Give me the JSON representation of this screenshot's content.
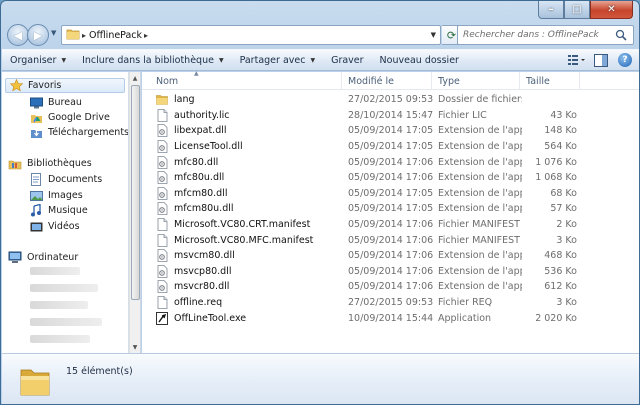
{
  "address": {
    "crumb": "OfflinePack"
  },
  "search": {
    "placeholder": "Rechercher dans : OfflinePack"
  },
  "toolbar": {
    "organize": "Organiser",
    "include_library": "Inclure dans la bibliothèque",
    "share_with": "Partager avec",
    "burn": "Graver",
    "new_folder": "Nouveau dossier"
  },
  "nav": {
    "favorites": "Favoris",
    "desktop": "Bureau",
    "google_drive": "Google Drive",
    "downloads": "Téléchargements",
    "libraries": "Bibliothèques",
    "documents": "Documents",
    "images": "Images",
    "music": "Musique",
    "videos": "Vidéos",
    "computer": "Ordinateur"
  },
  "columns": {
    "name": "Nom",
    "modified": "Modifié le",
    "type": "Type",
    "size": "Taille"
  },
  "files": [
    {
      "name": "lang",
      "date": "27/02/2015 09:53",
      "type": "Dossier de fichiers",
      "size": "",
      "icon": "folder-icon"
    },
    {
      "name": "authority.lic",
      "date": "28/10/2014 15:47",
      "type": "Fichier LIC",
      "size": "43 Ko",
      "icon": "file-icon"
    },
    {
      "name": "libexpat.dll",
      "date": "05/09/2014 17:05",
      "type": "Extension de l'app...",
      "size": "148 Ko",
      "icon": "dll-icon"
    },
    {
      "name": "LicenseTool.dll",
      "date": "05/09/2014 17:05",
      "type": "Extension de l'app...",
      "size": "564 Ko",
      "icon": "dll-icon"
    },
    {
      "name": "mfc80.dll",
      "date": "05/09/2014 17:06",
      "type": "Extension de l'app...",
      "size": "1 076 Ko",
      "icon": "dll-icon"
    },
    {
      "name": "mfc80u.dll",
      "date": "05/09/2014 17:06",
      "type": "Extension de l'app...",
      "size": "1 068 Ko",
      "icon": "dll-icon"
    },
    {
      "name": "mfcm80.dll",
      "date": "05/09/2014 17:05",
      "type": "Extension de l'app...",
      "size": "68 Ko",
      "icon": "dll-icon"
    },
    {
      "name": "mfcm80u.dll",
      "date": "05/09/2014 17:05",
      "type": "Extension de l'app...",
      "size": "57 Ko",
      "icon": "dll-icon"
    },
    {
      "name": "Microsoft.VC80.CRT.manifest",
      "date": "05/09/2014 17:06",
      "type": "Fichier MANIFEST",
      "size": "2 Ko",
      "icon": "file-icon"
    },
    {
      "name": "Microsoft.VC80.MFC.manifest",
      "date": "05/09/2014 17:06",
      "type": "Fichier MANIFEST",
      "size": "3 Ko",
      "icon": "file-icon"
    },
    {
      "name": "msvcm80.dll",
      "date": "05/09/2014 17:06",
      "type": "Extension de l'app...",
      "size": "468 Ko",
      "icon": "dll-icon"
    },
    {
      "name": "msvcp80.dll",
      "date": "05/09/2014 17:06",
      "type": "Extension de l'app...",
      "size": "536 Ko",
      "icon": "dll-icon"
    },
    {
      "name": "msvcr80.dll",
      "date": "05/09/2014 17:06",
      "type": "Extension de l'app...",
      "size": "612 Ko",
      "icon": "dll-icon"
    },
    {
      "name": "offline.req",
      "date": "27/02/2015 09:53",
      "type": "Fichier REQ",
      "size": "3 Ko",
      "icon": "file-icon"
    },
    {
      "name": "OffLineTool.exe",
      "date": "10/09/2014 15:44",
      "type": "Application",
      "size": "2 020 Ko",
      "icon": "exe-icon"
    }
  ],
  "status": {
    "count": "15 élément(s)"
  }
}
